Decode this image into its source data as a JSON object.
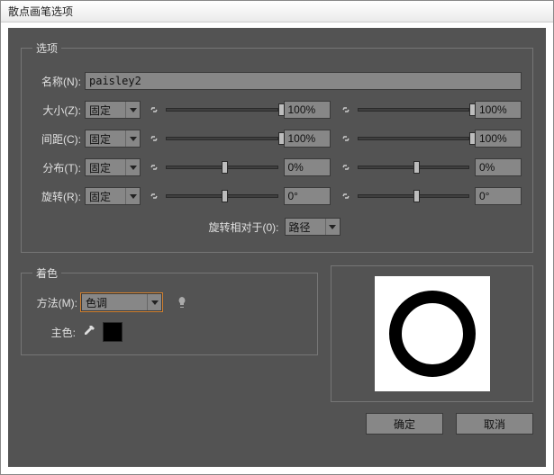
{
  "title": "散点画笔选项",
  "options": {
    "legend": "选项",
    "name_label": "名称(N):",
    "name_value": "paisley2",
    "rows": [
      {
        "label": "大小(Z):",
        "mode": "固定",
        "val1": "100%",
        "val2": "100%",
        "thumb1": 100,
        "thumb2": 100
      },
      {
        "label": "间距(C):",
        "mode": "固定",
        "val1": "100%",
        "val2": "100%",
        "thumb1": 100,
        "thumb2": 100
      },
      {
        "label": "分布(T):",
        "mode": "固定",
        "val1": "0%",
        "val2": "0%",
        "thumb1": 50,
        "thumb2": 50
      },
      {
        "label": "旋转(R):",
        "mode": "固定",
        "val1": "0°",
        "val2": "0°",
        "thumb1": 50,
        "thumb2": 50
      }
    ],
    "rot_rel_label": "旋转相对于(0):",
    "rot_rel_value": "路径"
  },
  "colorization": {
    "legend": "着色",
    "method_label": "方法(M):",
    "method_value": "色调",
    "key_label": "主色:",
    "swatch": "#000000"
  },
  "buttons": {
    "ok": "确定",
    "cancel": "取消"
  }
}
